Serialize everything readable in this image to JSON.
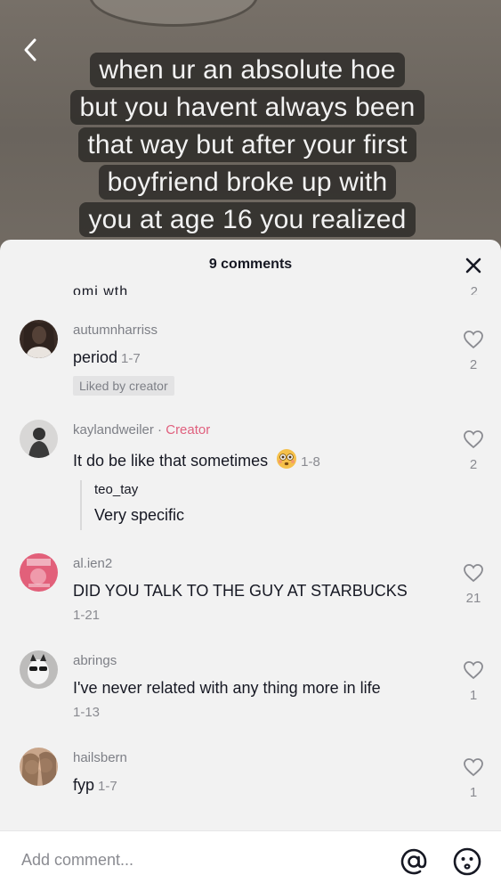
{
  "video": {
    "caption_lines": [
      "when ur an absolute hoe",
      "but you havent always been",
      "that way but after your first",
      "boyfriend broke up with",
      "you at age 16 you realized"
    ]
  },
  "sheet": {
    "title": "9 comments",
    "peek": {
      "text": "omi wth",
      "count": "2"
    }
  },
  "comments": [
    {
      "username": "autumnharriss",
      "text": "period",
      "date": "1-7",
      "badge": "Liked by creator",
      "likes": "2"
    },
    {
      "username": "kaylandweiler",
      "separator": " · ",
      "tag": "Creator",
      "text": "It do be like that sometimes",
      "emoji": "flushed-face",
      "date": "1-8",
      "likes": "2",
      "reply": {
        "username": "teo_tay",
        "text": "Very specific"
      }
    },
    {
      "username": "al.ien2",
      "text": "DID YOU TALK TO THE GUY AT STARBUCKS",
      "date": "1-21",
      "likes": "21"
    },
    {
      "username": "abrings",
      "text": "I've never related with any thing more in life",
      "date": "1-13",
      "likes": "1"
    },
    {
      "username": "hailsbern",
      "text": "fyp",
      "date": "1-7",
      "likes": "1"
    }
  ],
  "input": {
    "placeholder": "Add comment..."
  },
  "colors": {
    "creator": "#e0607e",
    "sheet_bg": "#f2f2f2",
    "text": "#161823",
    "muted": "#8a8b91"
  }
}
